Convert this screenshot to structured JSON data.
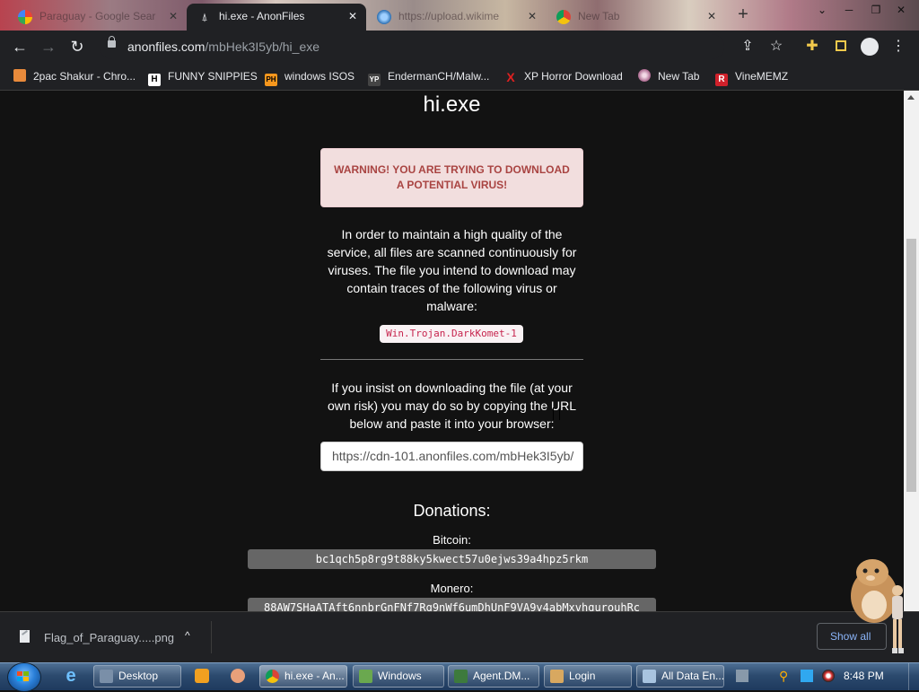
{
  "browser": {
    "tabs": [
      {
        "label": "Paraguay - Google Sear",
        "icon": "google-icon"
      },
      {
        "label": "hi.exe - AnonFiles",
        "icon": "anonfiles-icon",
        "active": true
      },
      {
        "label": "https://upload.wikime",
        "icon": "globe-icon"
      },
      {
        "label": "New Tab",
        "icon": "chrome-icon"
      }
    ],
    "new_tab_symbol": "+",
    "window_controls": [
      "⌄",
      "─",
      "❐",
      "✕"
    ],
    "url_host": "anonfiles.com",
    "url_path": "/mbHek3I5yb/hi_exe",
    "bookmarks": [
      {
        "label": "2pac Shakur - Chro...",
        "badge": "",
        "color": "#e88a3b"
      },
      {
        "label": "FUNNY SNIPPIES",
        "badge": "H",
        "color": "#ffffff"
      },
      {
        "label": "windows ISOS",
        "badge": "PH",
        "color": "#f7971d"
      },
      {
        "label": "EndermanCH/Malw...",
        "badge": "YP",
        "color": "#444444"
      },
      {
        "label": "XP Horror Download",
        "badge": "X",
        "color": "#e02020"
      },
      {
        "label": "New Tab",
        "badge": "",
        "color": "#c98ab0"
      },
      {
        "label": "VineMEMZ",
        "badge": "R",
        "color": "#d0212b"
      }
    ]
  },
  "page": {
    "title": "hi.exe",
    "warning": "WARNING! YOU ARE TRYING TO DOWNLOAD A POTENTIAL VIRUS!",
    "scan_text": "In order to maintain a high quality of the service, all files are scanned continuously for viruses. The file you intend to download may contain traces of the following virus or malware:",
    "virus_name": "Win.Trojan.DarkKomet-1",
    "insist_text": "If you insist on downloading the file (at your own risk) you may do so by copying the URL below and paste it into your browser:",
    "download_url": "https://cdn-101.anonfiles.com/mbHek3I5yb/",
    "donations_title": "Donations:",
    "bitcoin_label": "Bitcoin:",
    "bitcoin_address": "bc1qch5p8rg9t88ky5kwect57u0ejws39a4hpz5rkm",
    "monero_label": "Monero:",
    "monero_address": "88AW7SHaATAft6nnbrGnFNf7Rg9nWf6umDhUnF9VA9v4abMxvhgurouhRc"
  },
  "downloads": {
    "file_name": "Flag_of_Paraguay.....png",
    "caret": "^",
    "show_all_label": "Show all"
  },
  "taskbar": {
    "tasks": [
      {
        "label": "Desktop",
        "color": "#7a8fa8"
      },
      {
        "label": "hi.exe - An...",
        "color": "#e8b43a",
        "active": true
      },
      {
        "label": "Windows",
        "color": "#6aa84f"
      },
      {
        "label": "Agent.DM...",
        "color": "#3d7a3d"
      },
      {
        "label": "Login",
        "color": "#d8a860"
      },
      {
        "label": "All Data En...",
        "color": "#a8c4e0"
      }
    ],
    "clock": "8:48 PM"
  }
}
